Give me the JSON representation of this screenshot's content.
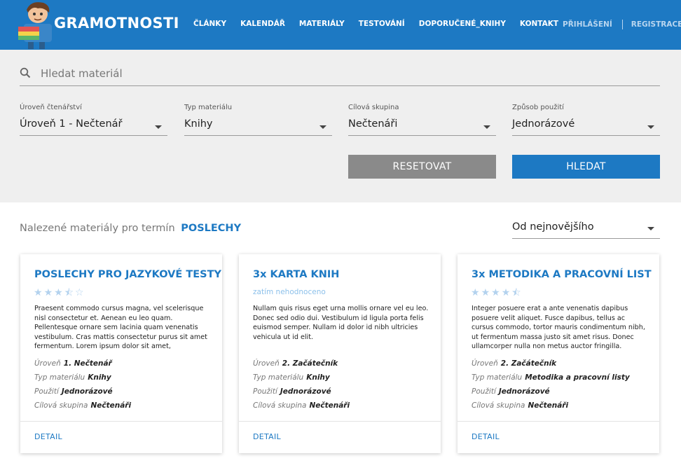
{
  "header": {
    "brand": "GRAMOTNOSTI",
    "nav": [
      "ČLÁNKY",
      "KALENDÁŘ",
      "MATERIÁLY",
      "TESTOVÁNÍ",
      "DOPORUČENÉ_KNIHY",
      "KONTAKT"
    ],
    "login": "PŘIHLÁŠENÍ",
    "register": "REGISTRACE"
  },
  "search": {
    "placeholder": "Hledat materiál",
    "value": ""
  },
  "filters": [
    {
      "label": "Úroveň čtenářství",
      "value": "Úroveň 1 - Nečtenář"
    },
    {
      "label": "Typ materiálu",
      "value": "Knihy"
    },
    {
      "label": "Cílová skupina",
      "value": "Nečtenáři"
    },
    {
      "label": "Způsob použití",
      "value": "Jednorázové"
    }
  ],
  "buttons": {
    "reset": "RESETOVAT",
    "search": "HLEDAT"
  },
  "results": {
    "label": "Nalezené materiály pro termín",
    "term": "POSLECHY",
    "sort": "Od nejnovějšího"
  },
  "cards": [
    {
      "title": "POSLECHY PRO JAZYKOVÉ TESTY",
      "rating": 3.5,
      "rating_text": "",
      "description": "Praesent commodo cursus magna, vel scelerisque nisl consectetur et. Aenean eu leo quam. Pellentesque ornare sem lacinia quam venenatis vestibulum. Cras mattis consectetur purus sit amet fermentum. Lorem ipsum dolor sit amet, consectetur adipiscing elit.",
      "meta": [
        {
          "key": "Úroveň",
          "value": "1. Nečtenář"
        },
        {
          "key": "Typ materiálu",
          "value": "Knihy"
        },
        {
          "key": "Použití",
          "value": "Jednorázové"
        },
        {
          "key": "Cílová skupina",
          "value": "Nečtenáři"
        }
      ],
      "detail": "DETAIL"
    },
    {
      "title": "3x KARTA KNIH",
      "rating": null,
      "rating_text": "zatím nehodnoceno",
      "description": "Nullam quis risus eget urna mollis ornare vel eu leo. Donec sed odio dui. Vestibulum id ligula porta felis euismod semper. Nullam id dolor id nibh ultricies vehicula ut id elit.",
      "meta": [
        {
          "key": "Úroveň",
          "value": "2. Začátečník"
        },
        {
          "key": "Typ materiálu",
          "value": "Knihy"
        },
        {
          "key": "Použití",
          "value": "Jednorázové"
        },
        {
          "key": "Cílová skupina",
          "value": "Nečtenáři"
        }
      ],
      "detail": "DETAIL"
    },
    {
      "title": "3x METODIKA A PRACOVNÍ LIST",
      "rating": 4.5,
      "rating_text": "",
      "description": "Integer posuere erat a ante venenatis dapibus posuere velit aliquet. Fusce dapibus, tellus ac cursus commodo, tortor mauris condimentum nibh, ut fermentum massa justo sit amet risus. Donec ullamcorper nulla non metus auctor fringilla. Vestibulum id ligula porta",
      "meta": [
        {
          "key": "Úroveň",
          "value": "2. Začátečník"
        },
        {
          "key": "Typ materiálu",
          "value": "Metodika a pracovní listy"
        },
        {
          "key": "Použití",
          "value": "Jednorázové"
        },
        {
          "key": "Cílová skupina",
          "value": "Nečtenáři"
        }
      ],
      "detail": "DETAIL"
    }
  ],
  "colors": {
    "primary": "#1d79c3",
    "panel": "#efefef",
    "reset_button": "#8a8a8a",
    "star": "#b3d2ee"
  }
}
